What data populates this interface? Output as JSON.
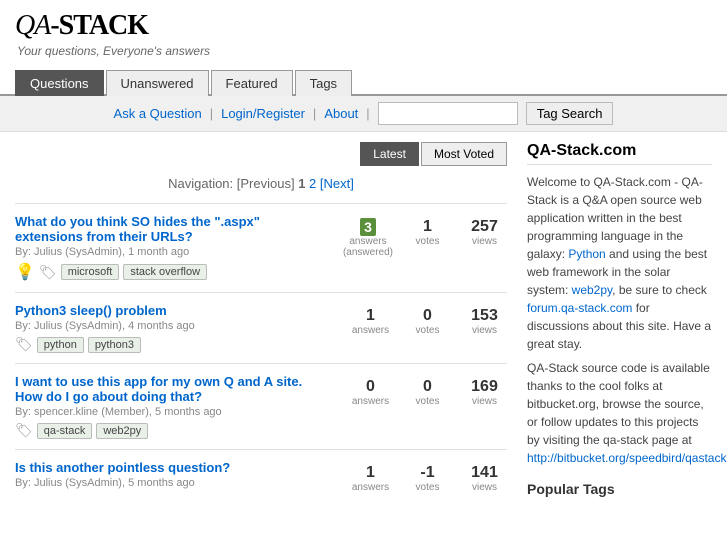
{
  "header": {
    "logo": "QA-STACK",
    "tagline": "Your questions, Everyone's answers"
  },
  "nav": {
    "tabs": [
      {
        "label": "Questions",
        "active": true
      },
      {
        "label": "Unanswered",
        "active": false
      },
      {
        "label": "Featured",
        "active": false
      },
      {
        "label": "Tags",
        "active": false
      }
    ]
  },
  "action_bar": {
    "ask_label": "Ask a Question",
    "login_label": "Login/Register",
    "about_label": "About",
    "search_placeholder": "",
    "tag_search_label": "Tag Search"
  },
  "sort": {
    "latest_label": "Latest",
    "most_voted_label": "Most Voted"
  },
  "pagination": {
    "prefix": "Navigation: [Previous]",
    "page1": "1",
    "page2": "2",
    "next_label": "[Next]"
  },
  "questions": [
    {
      "title": "What do you think SO hides the \".aspx\" extensions from their URLs?",
      "author": "Julius (SysAdmin)",
      "time": "1 month ago",
      "answers": "3",
      "answers_label": "answers",
      "answered": true,
      "answered_label": "(answered)",
      "votes": "1",
      "votes_label": "votes",
      "views": "257",
      "views_label": "views",
      "tags": [
        "microsoft",
        "stack overflow"
      ],
      "has_bulb": true
    },
    {
      "title": "Python3 sleep() problem",
      "author": "Julius (SysAdmin)",
      "time": "4 months ago",
      "answers": "1",
      "answers_label": "answers",
      "answered": false,
      "answered_label": "",
      "votes": "0",
      "votes_label": "votes",
      "views": "153",
      "views_label": "views",
      "tags": [
        "python",
        "python3"
      ],
      "has_bulb": false
    },
    {
      "title": "I want to use this app for my own Q and A site. How do I go about doing that?",
      "author": "spencer.kline (Member)",
      "time": "5 months ago",
      "answers": "0",
      "answers_label": "answers",
      "answered": false,
      "answered_label": "",
      "votes": "0",
      "votes_label": "votes",
      "views": "169",
      "views_label": "views",
      "tags": [
        "qa-stack",
        "web2py"
      ],
      "has_bulb": false
    },
    {
      "title": "Is this another pointless question?",
      "author": "Julius (SysAdmin)",
      "time": "5 months ago",
      "answers": "1",
      "answers_label": "answers",
      "answered": false,
      "answered_label": "",
      "votes": "-1",
      "votes_label": "votes",
      "views": "141",
      "views_label": "views",
      "tags": [],
      "has_bulb": false
    }
  ],
  "sidebar": {
    "title": "QA-Stack.com",
    "description_parts": [
      "Welcome to QA-Stack.com - QA-Stack is a Q&A open source web application written in the best programming language in the galaxy:",
      "and using the best web framework in the solar system:",
      ", be sure to check",
      "for discussions about this site. Have a great stay.",
      "QA-Stack source code is available thanks to the cool folks at bitbucket.org, browse the source, or follow updates to this projects by visiting the qa-stack page at"
    ],
    "python_link_text": "Python",
    "web2py_link_text": "web2py",
    "forum_link_text": "forum.qa-stack.com",
    "bitbucket_link_text": "http://bitbucket.org/speedbird/qastack",
    "popular_tags_title": "Popular Tags"
  }
}
